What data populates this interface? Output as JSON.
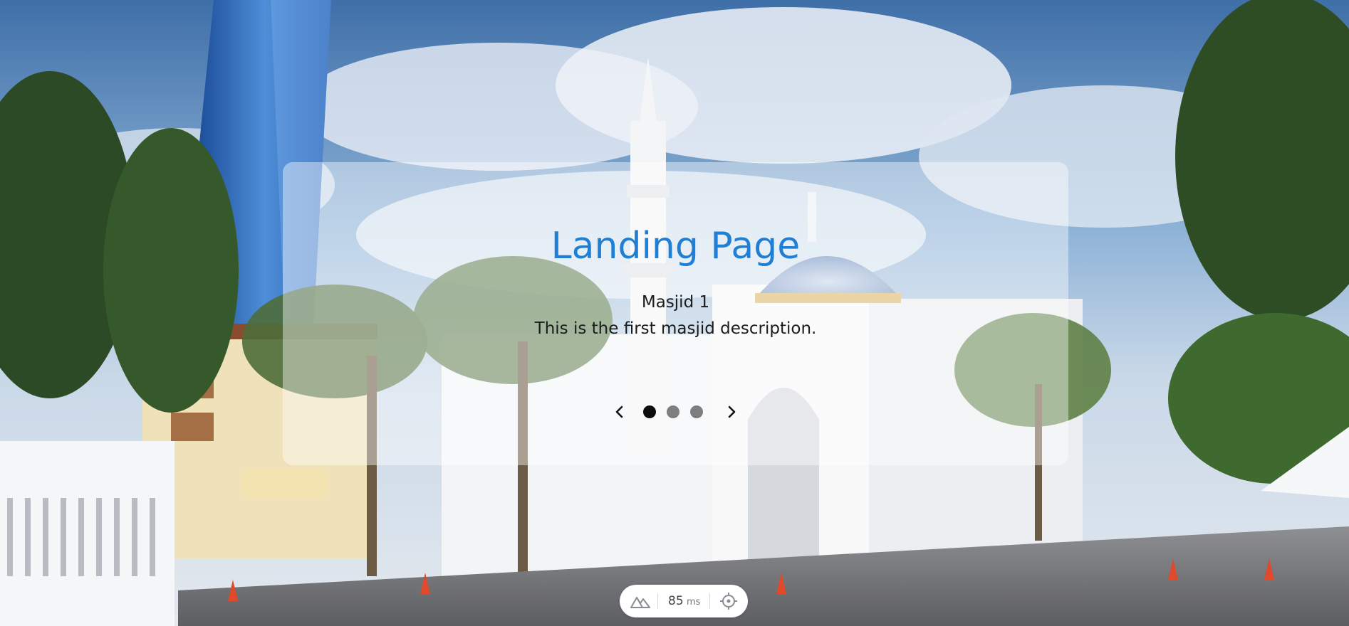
{
  "hero": {
    "title": "Landing Page"
  },
  "carousel": {
    "slides": [
      {
        "title": "Masjid 1",
        "description": "This is the first masjid description."
      }
    ],
    "active_index": 0,
    "dot_count": 3,
    "prev_icon": "chevron-left-icon",
    "next_icon": "chevron-right-icon"
  },
  "perf_indicator": {
    "value": "85",
    "unit": "ms",
    "logo_icon": "nuxt-logo-icon",
    "locate_icon": "crosshair-icon"
  },
  "colors": {
    "accent": "#1f7ed6",
    "dot_active": "#0c0c0c",
    "dot_inactive": "#7e7e7e"
  }
}
